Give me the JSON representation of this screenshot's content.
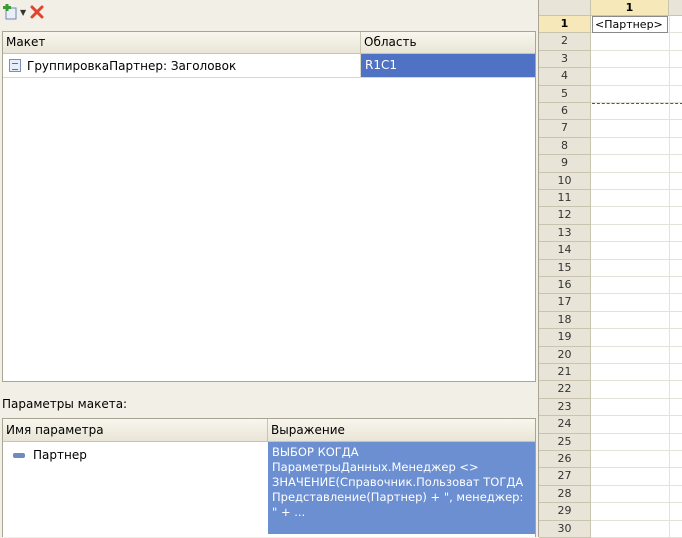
{
  "layouts_table": {
    "columns": [
      "Макет",
      "Область"
    ],
    "rows": [
      {
        "name": "ГруппировкаПартнер: Заголовок",
        "area": "R1C1"
      }
    ]
  },
  "parameters_label": "Параметры макета:",
  "params_table": {
    "columns": [
      "Имя параметра",
      "Выражение"
    ],
    "rows": [
      {
        "name": "Партнер",
        "expression": "ВЫБОР КОГДА ПараметрыДанных.Менеджер <> ЗНАЧЕНИЕ(Справочник.Пользоват ТОГДА Представление(Партнер) + \", менеджер: \" + ..."
      }
    ]
  },
  "sheet": {
    "column_label": "1",
    "cell_value": "<Партнер>",
    "row_numbers": [
      "1",
      "2",
      "3",
      "4",
      "5",
      "6",
      "7",
      "8",
      "9",
      "10",
      "11",
      "12",
      "13",
      "14",
      "15",
      "16",
      "17",
      "18",
      "19",
      "20",
      "21",
      "22",
      "23",
      "24",
      "25",
      "26",
      "27",
      "28",
      "29",
      "30"
    ]
  },
  "icons": {
    "add": "add-icon",
    "delete": "delete-icon",
    "template": "template-icon",
    "parameter": "parameter-icon"
  },
  "colors": {
    "selection": "#4f72c4",
    "expression_bg": "#6b8fd1",
    "panel_bg": "#f2efe6",
    "selected_header": "#f6e8b8"
  }
}
